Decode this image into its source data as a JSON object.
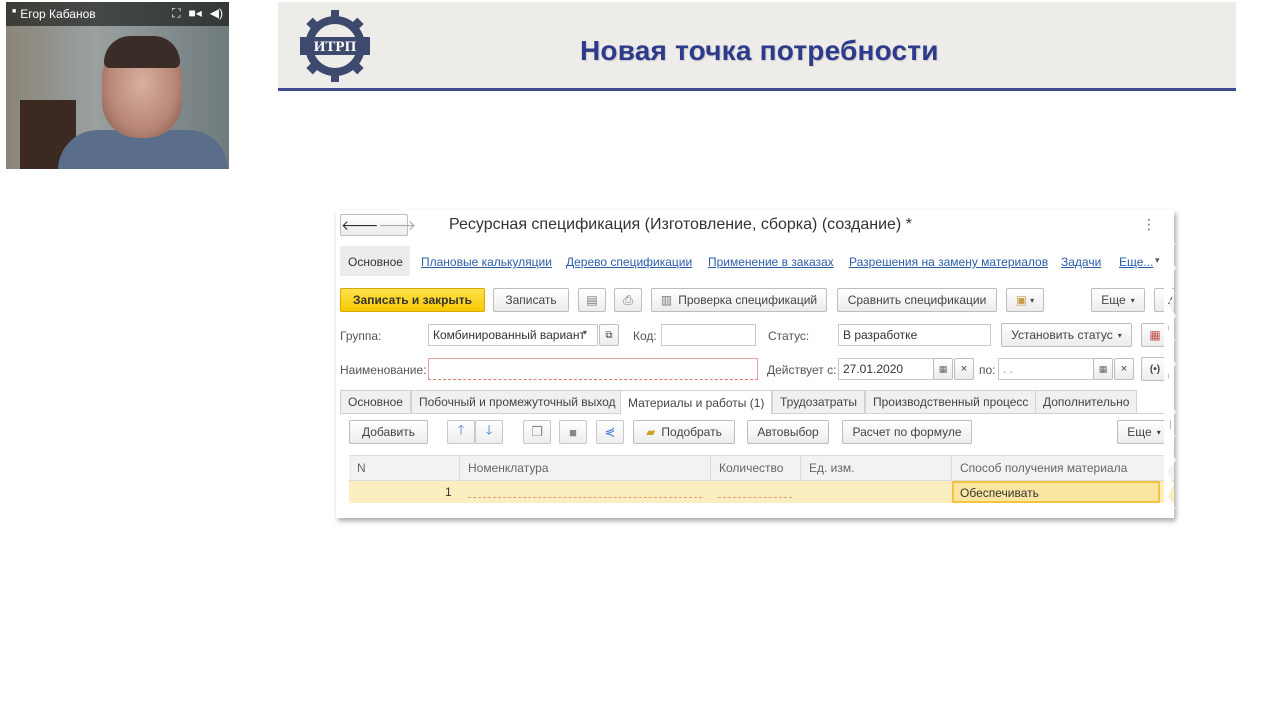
{
  "webcam": {
    "participant_name": "Егор Кабанов",
    "icons": [
      "fullscreen-icon",
      "camera-icon",
      "speaker-icon"
    ]
  },
  "slide": {
    "title": "Новая точка потребности",
    "logo_text": "ИТРП",
    "accent_color": "#2e3a8c"
  },
  "form": {
    "window_title": "Ресурсная спецификация (Изготовление, сборка) (создание) *",
    "nav": {
      "back_icon": "arrow-left-icon",
      "forward_icon": "arrow-right-icon",
      "menu_icon": "more-vertical-icon"
    },
    "section_links": {
      "active": "Основное",
      "items": [
        "Плановые калькуляции",
        "Дерево спецификации",
        "Применение в заказах",
        "Разрешения на замену материалов",
        "Задачи",
        "Еще..."
      ]
    },
    "toolbar": {
      "save_close": "Записать и закрыть",
      "save": "Записать",
      "check_spec": "Проверка спецификаций",
      "compare_spec": "Сравнить спецификации",
      "more": "Еще",
      "help": "?"
    },
    "fields": {
      "group_label": "Группа:",
      "group_value": "Комбинированный вариант",
      "code_label": "Код:",
      "code_value": "",
      "status_label": "Статус:",
      "status_value": "В разработке",
      "set_status": "Установить статус",
      "name_label": "Наименование:",
      "name_value": "",
      "valid_from_label": "Действует с:",
      "valid_from_value": "27.01.2020",
      "valid_to_label": "по:",
      "valid_to_value": ". ."
    },
    "tabs": [
      "Основное",
      "Побочный и промежуточный выход",
      "Материалы и работы (1)",
      "Трудозатраты",
      "Производственный процесс",
      "Дополнительно"
    ],
    "active_tab": 2,
    "table_toolbar": {
      "add": "Добавить",
      "pick": "Подобрать",
      "auto_pick": "Автовыбор",
      "calc_formula": "Расчет по формуле",
      "more": "Еще"
    },
    "table": {
      "columns": [
        "N",
        "Номенклатура",
        "Количество",
        "Ед. изм.",
        "Способ получения материала"
      ],
      "rows": [
        {
          "n": "1",
          "nomenclature": "",
          "quantity": "",
          "unit": "",
          "method": "Обеспечивать"
        }
      ]
    }
  }
}
